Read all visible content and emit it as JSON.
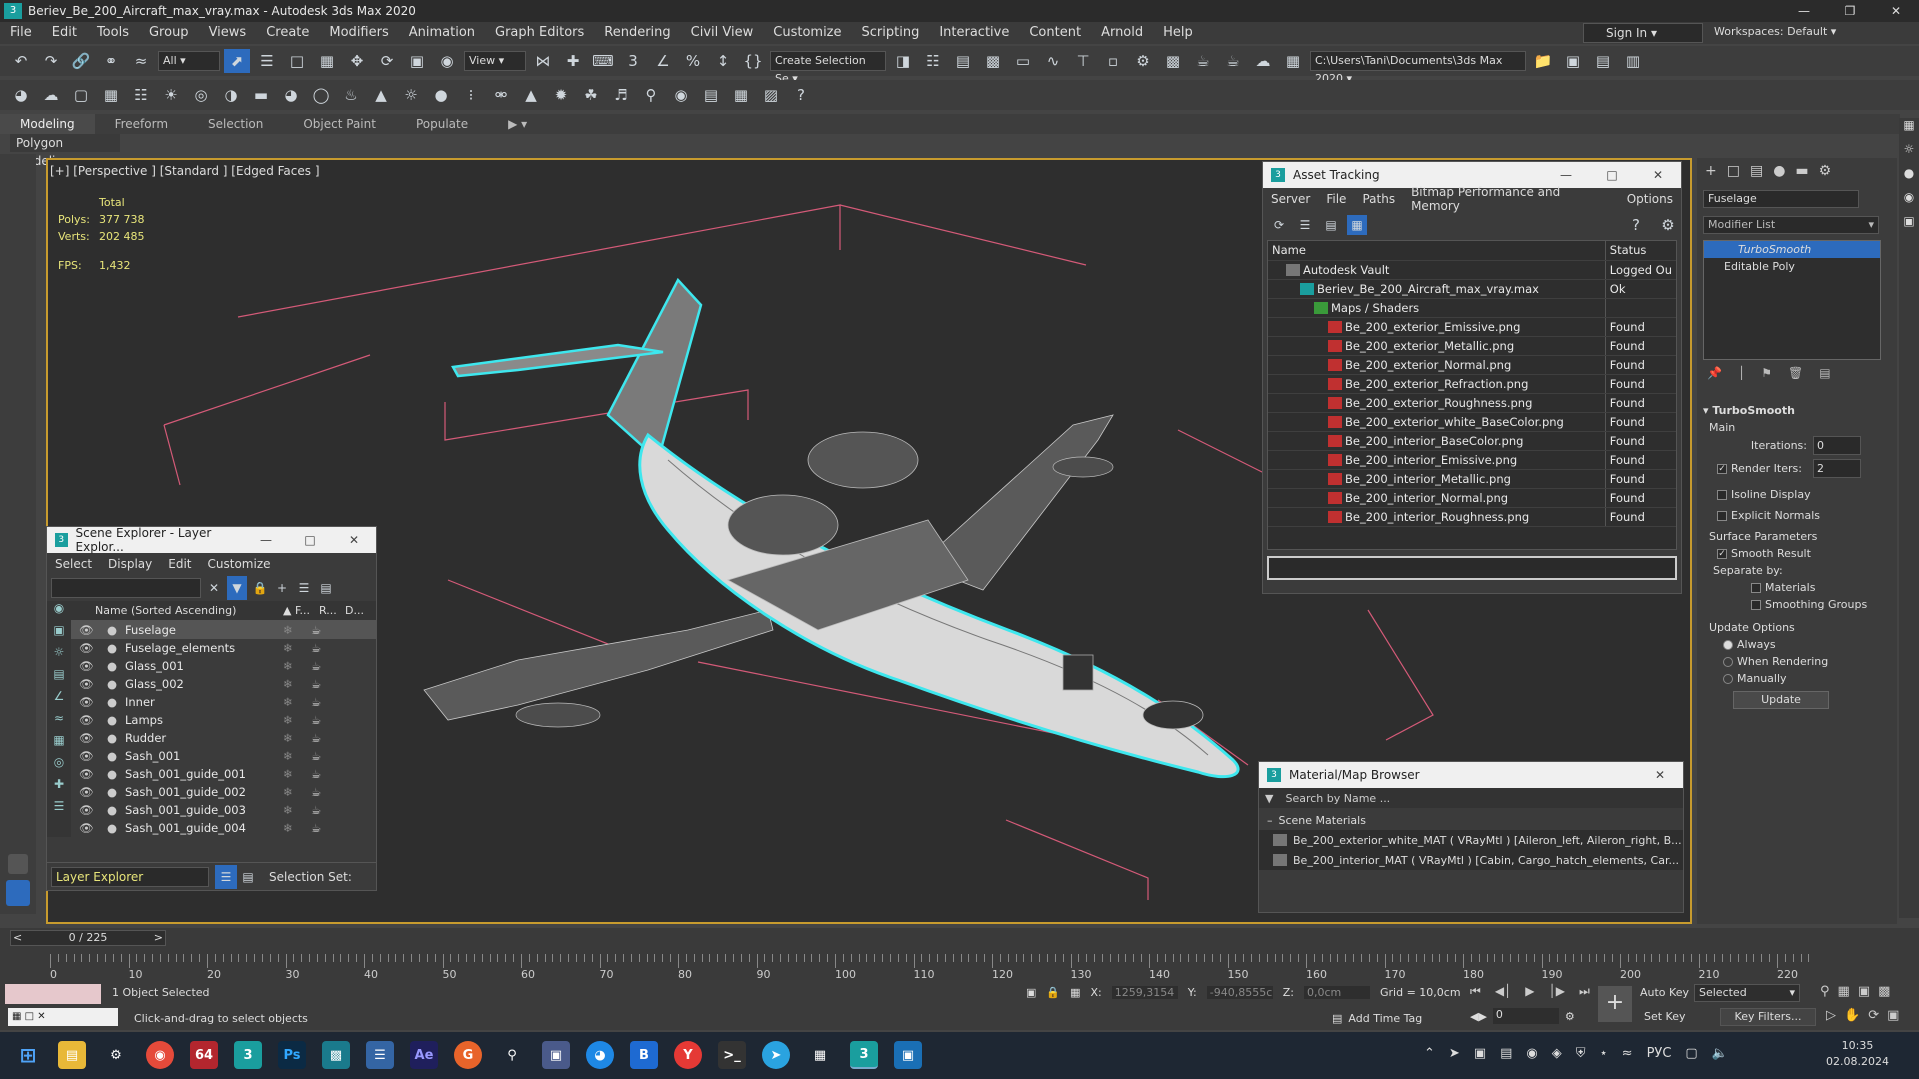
{
  "title": "Beriev_Be_200_Aircraft_max_vray.max - Autodesk 3ds Max 2020",
  "menu": [
    "File",
    "Edit",
    "Tools",
    "Group",
    "Views",
    "Create",
    "Modifiers",
    "Animation",
    "Graph Editors",
    "Rendering",
    "Civil View",
    "Customize",
    "Scripting",
    "Interactive",
    "Content",
    "Arnold",
    "Help"
  ],
  "signin": "Sign In",
  "workspaces_label": "Workspaces:",
  "workspace_value": "Default",
  "toolbar": {
    "filter": "All",
    "view": "View",
    "selection_set": "Create Selection Se",
    "path": "C:\\Users\\Tani\\Documents\\3ds Max 2020"
  },
  "ribbon_tabs": [
    "Modeling",
    "Freeform",
    "Selection",
    "Object Paint",
    "Populate"
  ],
  "polygon_modeling": "Polygon Modeling",
  "viewport": {
    "label": "[+] [Perspective ] [Standard ] [Edged Faces ]",
    "stats_total": "Total",
    "polys_label": "Polys:",
    "polys": "377 738",
    "verts_label": "Verts:",
    "verts": "202 485",
    "fps_label": "FPS:",
    "fps": "1,432"
  },
  "asset_tracking": {
    "title": "Asset Tracking",
    "menu": [
      "Server",
      "File",
      "Paths",
      "Bitmap Performance and Memory",
      "Options"
    ],
    "col_name": "Name",
    "col_status": "Status",
    "rows": [
      {
        "name": "Autodesk Vault",
        "status": "Logged Ou",
        "indent": 1
      },
      {
        "name": "Beriev_Be_200_Aircraft_max_vray.max",
        "status": "Ok",
        "indent": 2
      },
      {
        "name": "Maps / Shaders",
        "status": "",
        "indent": 3
      },
      {
        "name": "Be_200_exterior_Emissive.png",
        "status": "Found",
        "indent": 4
      },
      {
        "name": "Be_200_exterior_Metallic.png",
        "status": "Found",
        "indent": 4
      },
      {
        "name": "Be_200_exterior_Normal.png",
        "status": "Found",
        "indent": 4
      },
      {
        "name": "Be_200_exterior_Refraction.png",
        "status": "Found",
        "indent": 4
      },
      {
        "name": "Be_200_exterior_Roughness.png",
        "status": "Found",
        "indent": 4
      },
      {
        "name": "Be_200_exterior_white_BaseColor.png",
        "status": "Found",
        "indent": 4
      },
      {
        "name": "Be_200_interior_BaseColor.png",
        "status": "Found",
        "indent": 4
      },
      {
        "name": "Be_200_interior_Emissive.png",
        "status": "Found",
        "indent": 4
      },
      {
        "name": "Be_200_interior_Metallic.png",
        "status": "Found",
        "indent": 4
      },
      {
        "name": "Be_200_interior_Normal.png",
        "status": "Found",
        "indent": 4
      },
      {
        "name": "Be_200_interior_Roughness.png",
        "status": "Found",
        "indent": 4
      }
    ]
  },
  "scene_explorer": {
    "title": "Scene Explorer - Layer Explor...",
    "menu": [
      "Select",
      "Display",
      "Edit",
      "Customize"
    ],
    "col_name": "Name (Sorted Ascending)",
    "col_f": "▲ F...",
    "col_r": "R...",
    "col_d": "D...",
    "items": [
      "Fuselage",
      "Fuselage_elements",
      "Glass_001",
      "Glass_002",
      "Inner",
      "Lamps",
      "Rudder",
      "Sash_001",
      "Sash_001_guide_001",
      "Sash_001_guide_002",
      "Sash_001_guide_003",
      "Sash_001_guide_004"
    ],
    "footer_explorer": "Layer Explorer",
    "footer_selset": "Selection Set:"
  },
  "material_browser": {
    "title": "Material/Map Browser",
    "search_placeholder": "Search by Name ...",
    "section": "Scene Materials",
    "items": [
      "Be_200_exterior_white_MAT ( VRayMtl ) [Aileron_left, Aileron_right, B...",
      "Be_200_interior_MAT ( VRayMtl ) [Cabin, Cargo_hatch_elements, Car..."
    ]
  },
  "command_panel": {
    "object_name": "Fuselage",
    "modifier_list": "Modifier List",
    "stack": [
      "TurboSmooth",
      "Editable Poly"
    ],
    "rollout": "TurboSmooth",
    "main": "Main",
    "iterations_label": "Iterations:",
    "iterations": "0",
    "render_iters_label": "Render Iters:",
    "render_iters": "2",
    "isoline": "Isoline Display",
    "explicit": "Explicit Normals",
    "surface_params": "Surface Parameters",
    "smooth_result": "Smooth Result",
    "separate_by": "Separate by:",
    "materials": "Materials",
    "smoothing_groups": "Smoothing Groups",
    "update_options": "Update Options",
    "always": "Always",
    "when_rendering": "When Rendering",
    "manually": "Manually",
    "update_btn": "Update"
  },
  "timeline": {
    "frame": "0 / 225",
    "ticks": [
      "0",
      "10",
      "20",
      "30",
      "40",
      "50",
      "60",
      "70",
      "80",
      "90",
      "100",
      "110",
      "120",
      "130",
      "140",
      "150",
      "160",
      "170",
      "180",
      "190",
      "200",
      "210",
      "220"
    ]
  },
  "status": {
    "selected": "1 Object Selected",
    "hint": "Click-and-drag to select objects",
    "x_label": "X:",
    "x": "1259,3154",
    "y_label": "Y:",
    "y": "-940,8555c",
    "z_label": "Z:",
    "z": "0,0cm",
    "grid": "Grid = 10,0cm",
    "add_time_tag": "Add Time Tag",
    "auto_key": "Auto Key",
    "set_key": "Set Key",
    "selected_dd": "Selected",
    "key_filters": "Key Filters...",
    "frame_field": "0"
  },
  "taskbar": {
    "lang": "РУС",
    "time": "10:35",
    "date": "02.08.2024",
    "apps": [
      "Ps",
      "Ae",
      "64",
      "G",
      "B",
      "Y"
    ]
  },
  "colors": {
    "accent": "#5bc8f5",
    "selection": "#2d6bbd",
    "viewport_border": "#c79b2e",
    "wire_select": "#3ee7ee"
  }
}
